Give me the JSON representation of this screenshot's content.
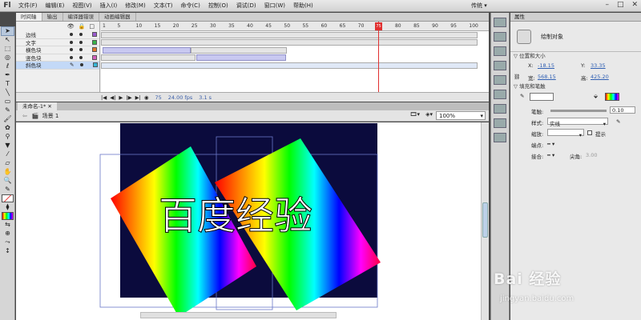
{
  "app": {
    "logo": "Fl",
    "workspace": "传统 ▾"
  },
  "menu": [
    "文件(F)",
    "编辑(E)",
    "视图(V)",
    "插入(I)",
    "修改(M)",
    "文本(T)",
    "命令(C)",
    "控制(O)",
    "调试(D)",
    "窗口(W)",
    "帮助(H)"
  ],
  "timeline": {
    "tabs": [
      "时间轴",
      "输出",
      "编译器错误",
      "动画编辑器"
    ],
    "ruler_ticks": [
      "1",
      "5",
      "10",
      "15",
      "20",
      "25",
      "30",
      "35",
      "40",
      "45",
      "50",
      "55",
      "60",
      "65",
      "70",
      "75",
      "80",
      "85",
      "90",
      "95",
      "100"
    ],
    "layers": [
      "边线",
      "文字",
      "横色块",
      "竖色块",
      "斜色块"
    ],
    "playhead": "75",
    "status": {
      "frame": "75",
      "fps": "24.00 fps",
      "time": "3.1 s"
    }
  },
  "document": {
    "tab": "未命名-1*",
    "scene": "场景 1",
    "zoom": "100%"
  },
  "stage": {
    "text": "百度经验",
    "background": "#0b0b3d"
  },
  "properties": {
    "tab": "属性",
    "object": "绘制对象",
    "position_section": "位置和大小",
    "x_label": "X:",
    "x": "-18.15",
    "y_label": "Y:",
    "y": "33.35",
    "w_label": "宽:",
    "w": "568.15",
    "h_label": "高:",
    "h": "425.20",
    "fill_section": "填充和笔触",
    "stroke_label": "笔触:",
    "stroke_value": "0.10",
    "style_label": "样式:",
    "style_value": "实线",
    "scale_label": "缩放:",
    "hint_label": "提示",
    "cap_label": "端点:",
    "cap_value": "━ ▾",
    "join_label": "接合:",
    "join_value": "━ ▾",
    "miter_label": "尖角:",
    "miter_value": "3.00"
  },
  "watermark": {
    "text": "Bai 经验",
    "url": "jingyan.baidu.com"
  }
}
